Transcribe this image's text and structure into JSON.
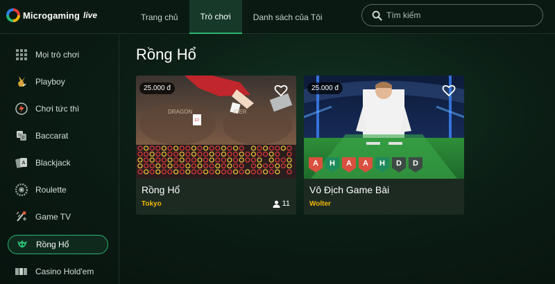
{
  "header": {
    "brand": "Microgaming",
    "brand_suffix": "live",
    "nav": [
      {
        "label": "Trang chủ",
        "active": false
      },
      {
        "label": "Trò chơi",
        "active": true
      },
      {
        "label": "Danh sách của Tôi",
        "active": false
      }
    ],
    "search": {
      "placeholder": "Tìm kiếm",
      "value": "",
      "icon": "search-icon"
    }
  },
  "sidebar": {
    "items": [
      {
        "label": "Mọi trò chơi",
        "icon": "grid-icon",
        "active": false
      },
      {
        "label": "Playboy",
        "icon": "playboy-bunny-icon",
        "active": false
      },
      {
        "label": "Chơi tức thì",
        "icon": "lightning-icon",
        "active": false
      },
      {
        "label": "Baccarat",
        "icon": "baccarat-icon",
        "active": false
      },
      {
        "label": "Blackjack",
        "icon": "cards-icon",
        "active": false
      },
      {
        "label": "Roulette",
        "icon": "roulette-icon",
        "active": false
      },
      {
        "label": "Game TV",
        "icon": "game-tv-icon",
        "active": false
      },
      {
        "label": "Rồng Hổ",
        "icon": "dragon-tiger-icon",
        "active": true
      },
      {
        "label": "Casino Hold'em",
        "icon": "holdem-icon",
        "active": false
      }
    ]
  },
  "main": {
    "title": "Rồng Hổ",
    "cards": [
      {
        "name": "Rồng Hổ",
        "dealer": "Tokyo",
        "price": "25.000 đ",
        "players": "11",
        "table_text": "DRAGON",
        "table_text_2": "IGER"
      },
      {
        "name": "Vô Địch Game Bài",
        "dealer": "Wolter",
        "price": "25.000 đ",
        "players": "",
        "results": [
          "A",
          "H",
          "A",
          "A",
          "H",
          "D",
          "D"
        ]
      }
    ]
  },
  "colors": {
    "accent": "#2bb673",
    "dealer_name": "#f2b705",
    "result_A": "#d9503f",
    "result_H": "#1f8a5a",
    "result_D": "#3c4a44"
  }
}
